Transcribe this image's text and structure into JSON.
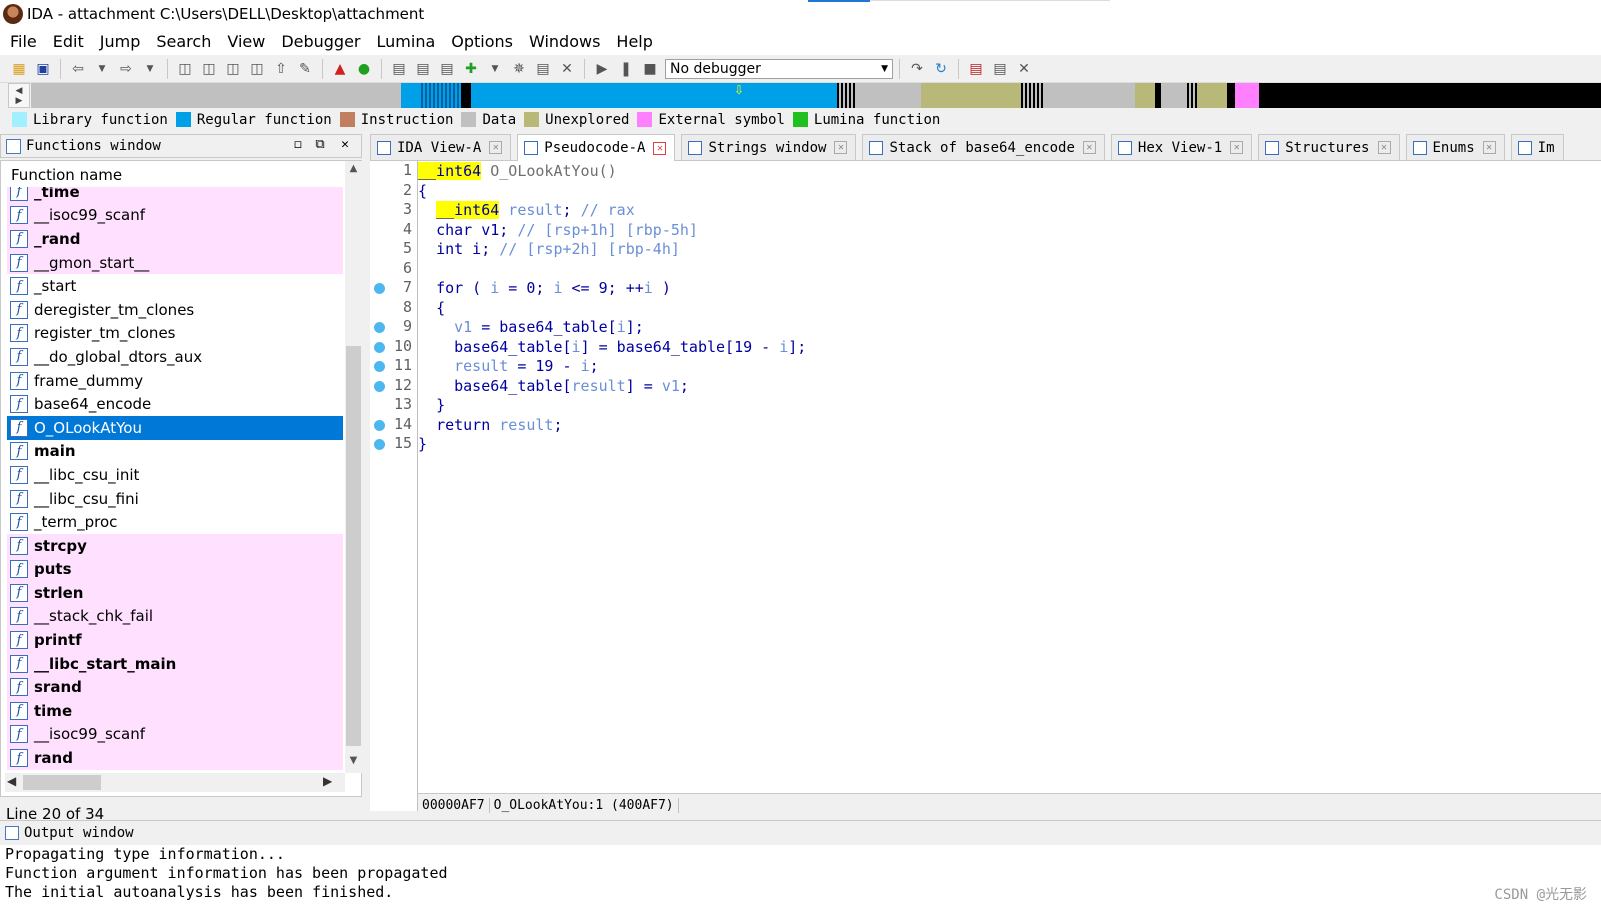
{
  "window": {
    "title": "IDA - attachment C:\\Users\\DELL\\Desktop\\attachment"
  },
  "menu": [
    "File",
    "Edit",
    "Jump",
    "Search",
    "View",
    "Debugger",
    "Lumina",
    "Options",
    "Windows",
    "Help"
  ],
  "toolbar": {
    "debugger_select": "No debugger"
  },
  "legend": [
    {
      "label": "Library function",
      "color": "#a0f0ff"
    },
    {
      "label": "Regular function",
      "color": "#00a0e8"
    },
    {
      "label": "Instruction",
      "color": "#c08060"
    },
    {
      "label": "Data",
      "color": "#c0c0c0"
    },
    {
      "label": "Unexplored",
      "color": "#b8b878"
    },
    {
      "label": "External symbol",
      "color": "#ff80ff"
    },
    {
      "label": "Lumina function",
      "color": "#20c020"
    }
  ],
  "functions_window": {
    "title": "Functions window",
    "column_header": "Function name",
    "rows": [
      {
        "name": "_time",
        "bold": true,
        "pink": true
      },
      {
        "name": "__isoc99_scanf",
        "bold": false,
        "pink": true
      },
      {
        "name": "_rand",
        "bold": true,
        "pink": true
      },
      {
        "name": "__gmon_start__",
        "bold": false,
        "pink": true
      },
      {
        "name": "_start",
        "bold": false,
        "pink": false
      },
      {
        "name": "deregister_tm_clones",
        "bold": false,
        "pink": false
      },
      {
        "name": "register_tm_clones",
        "bold": false,
        "pink": false
      },
      {
        "name": "__do_global_dtors_aux",
        "bold": false,
        "pink": false
      },
      {
        "name": "frame_dummy",
        "bold": false,
        "pink": false
      },
      {
        "name": "base64_encode",
        "bold": false,
        "pink": false
      },
      {
        "name": "O_OLookAtYou",
        "bold": false,
        "pink": false,
        "selected": true
      },
      {
        "name": "main",
        "bold": true,
        "pink": false
      },
      {
        "name": "__libc_csu_init",
        "bold": false,
        "pink": false
      },
      {
        "name": "__libc_csu_fini",
        "bold": false,
        "pink": false
      },
      {
        "name": "_term_proc",
        "bold": false,
        "pink": false
      },
      {
        "name": "strcpy",
        "bold": true,
        "pink": true
      },
      {
        "name": "puts",
        "bold": true,
        "pink": true
      },
      {
        "name": "strlen",
        "bold": true,
        "pink": true
      },
      {
        "name": "__stack_chk_fail",
        "bold": false,
        "pink": true
      },
      {
        "name": "printf",
        "bold": true,
        "pink": true
      },
      {
        "name": "__libc_start_main",
        "bold": true,
        "pink": true
      },
      {
        "name": "srand",
        "bold": true,
        "pink": true
      },
      {
        "name": "time",
        "bold": true,
        "pink": true
      },
      {
        "name": "__isoc99_scanf",
        "bold": false,
        "pink": true
      },
      {
        "name": "rand",
        "bold": true,
        "pink": true
      }
    ],
    "status": "Line 20 of 34"
  },
  "tabs": [
    {
      "label": "IDA View-A",
      "active": false
    },
    {
      "label": "Pseudocode-A",
      "active": true
    },
    {
      "label": "Strings window",
      "active": false
    },
    {
      "label": "Stack of base64_encode",
      "active": false
    },
    {
      "label": "Hex View-1",
      "active": false
    },
    {
      "label": "Structures",
      "active": false
    },
    {
      "label": "Enums",
      "active": false
    },
    {
      "label": "Im",
      "active": false
    }
  ],
  "pseudocode": {
    "lines": [
      {
        "n": "1",
        "bp": false
      },
      {
        "n": "2",
        "bp": false
      },
      {
        "n": "3",
        "bp": false
      },
      {
        "n": "4",
        "bp": false
      },
      {
        "n": "5",
        "bp": false
      },
      {
        "n": "6",
        "bp": false
      },
      {
        "n": "7",
        "bp": true
      },
      {
        "n": "8",
        "bp": false
      },
      {
        "n": "9",
        "bp": true
      },
      {
        "n": "10",
        "bp": true
      },
      {
        "n": "11",
        "bp": true
      },
      {
        "n": "12",
        "bp": true
      },
      {
        "n": "13",
        "bp": false
      },
      {
        "n": "14",
        "bp": true
      },
      {
        "n": "15",
        "bp": true
      }
    ],
    "tokens": {
      "l1_type": "__int64",
      "l1_rest": " O_OLookAtYou()",
      "l2": "{",
      "l3_type": "__int64",
      "l3_var": " result",
      "l3_semi": "; ",
      "l3_cm": "// rax",
      "l4_kw": "char v1; ",
      "l4_cm": "// [rsp+1h] [rbp-5h]",
      "l5_kw": "int i; ",
      "l5_cm": "// [rsp+2h] [rbp-4h]",
      "l7_a": "for ( ",
      "l7_i1": "i",
      "l7_b": " = 0; ",
      "l7_i2": "i",
      "l7_c": " <= 9; ++",
      "l7_i3": "i",
      "l7_d": " )",
      "l8": "{",
      "l9_v": "v1",
      "l9_a": " = base64_table[",
      "l9_i": "i",
      "l9_b": "];",
      "l10_a": "base64_table[",
      "l10_i1": "i",
      "l10_b": "] = base64_table[19 - ",
      "l10_i2": "i",
      "l10_c": "];",
      "l11_r": "result",
      "l11_a": " = 19 - ",
      "l11_i": "i",
      "l11_b": ";",
      "l12_a": "base64_table[",
      "l12_r": "result",
      "l12_b": "] = ",
      "l12_v": "v1",
      "l12_c": ";",
      "l13": "}",
      "l14_a": "return ",
      "l14_r": "result",
      "l14_b": ";",
      "l15": "}"
    },
    "status_address": "00000AF7",
    "status_location": "O_OLookAtYou:1 (400AF7)"
  },
  "output_window": {
    "title": "Output window",
    "lines": [
      "Propagating type information...",
      "Function argument information has been propagated",
      "The initial autoanalysis has been finished."
    ]
  },
  "watermark": "CSDN @光无影"
}
